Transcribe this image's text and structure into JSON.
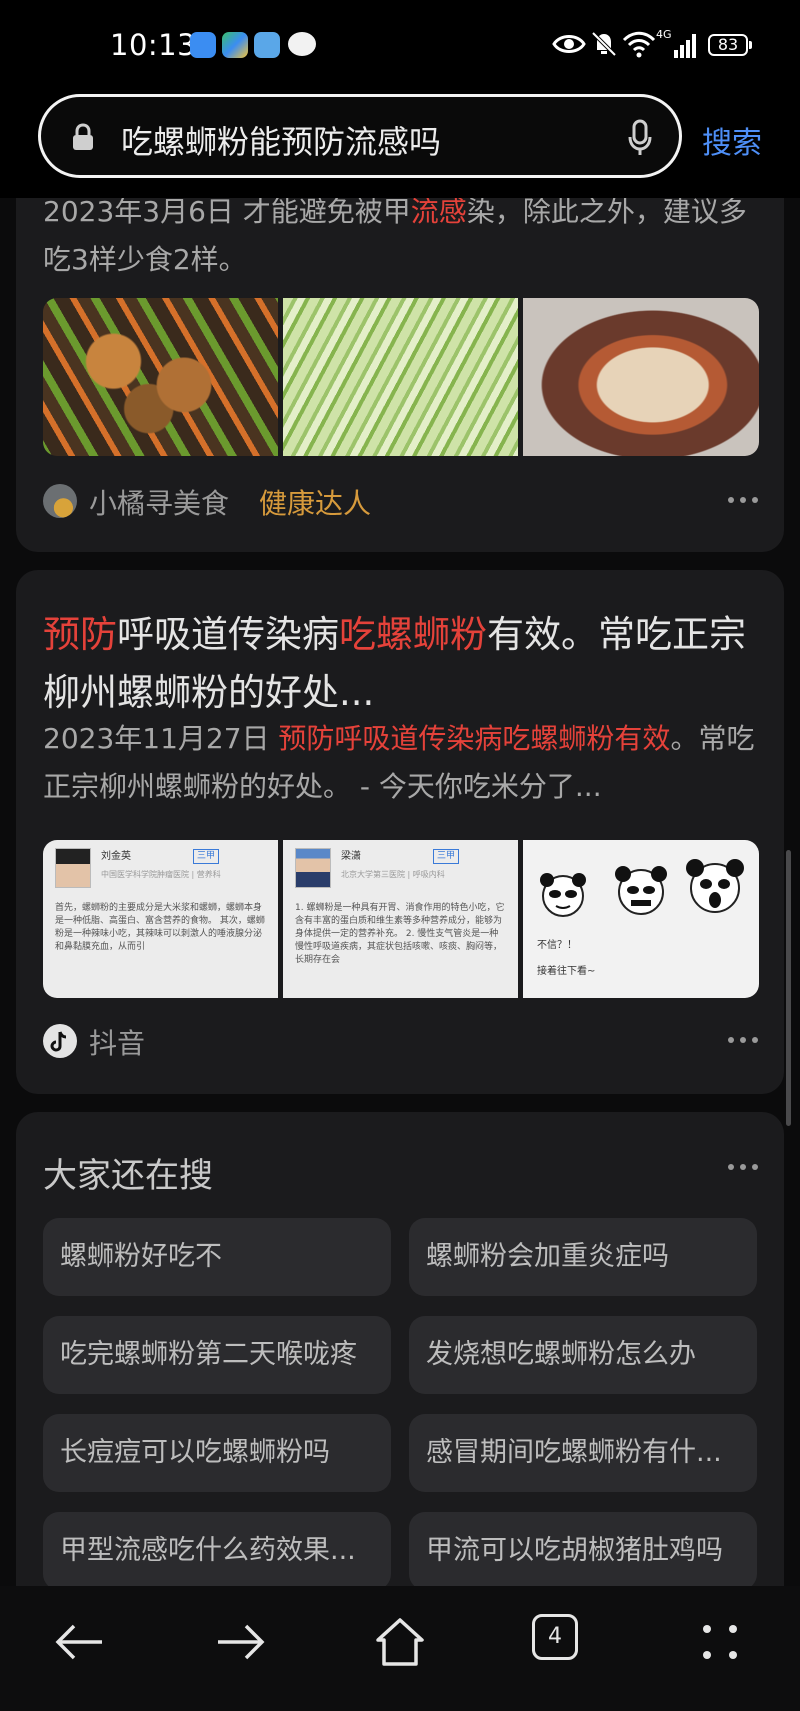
{
  "status_bar": {
    "time": "10:13",
    "network": "4G",
    "battery": "83"
  },
  "search": {
    "query": "吃螺蛳粉能预防流感吗",
    "button_label": "搜索"
  },
  "result1": {
    "date": "2023年3月6日",
    "snippet_pre": " 才能避免被甲",
    "snippet_hl": "流感",
    "snippet_post": "染，除此之外，建议多吃3样少食2样。",
    "source_name": "小橘寻美食",
    "source_tag": "健康达人"
  },
  "result2": {
    "title_hl1": "预防",
    "title_mid1": "呼吸道传染病",
    "title_hl2": "吃螺蛳粉",
    "title_rest": "有效。常吃正宗柳州螺蛳粉的好处...",
    "date": "2023年11月27日 ",
    "snippet_hl": "预防呼吸道传染病吃螺蛳粉有效",
    "snippet_post": "。常吃正宗柳州螺蛳粉的好处。 - 今天你吃米分了...",
    "source_name": "抖音",
    "thumb1": {
      "doctor": "刘金英",
      "level": "三甲",
      "dept": "中国医学科学院肿瘤医院 | 营养科",
      "text": "首先，螺蛳粉的主要成分是大米浆和螺蛳，螺蛳本身是一种低脂、高蛋白、富含营养的食物。 其次，螺蛳粉是一种辣味小吃，其辣味可以刺激人的唾液腺分泌和鼻黏膜充血，从而引"
    },
    "thumb2": {
      "doctor": "梁潇",
      "level": "三甲",
      "dept": "北京大学第三医院 | 呼吸内科",
      "text": "1. 螺蛳粉是一种具有开胃、消食作用的特色小吃，它含有丰富的蛋白质和维生素等多种营养成分，能够为身体提供一定的营养补充。 2. 慢性支气管炎是一种慢性呼吸道疾病，其症状包括咳嗽、咳痰、胸闷等，长期存在会"
    },
    "thumb3": {
      "line1": "不信？！",
      "line2": "接着往下看~"
    }
  },
  "related": {
    "title": "大家还在搜",
    "items": [
      "螺蛳粉好吃不",
      "螺蛳粉会加重炎症吗",
      "吃完螺蛳粉第二天喉咙疼",
      "发烧想吃螺蛳粉怎么办",
      "长痘痘可以吃螺蛳粉吗",
      "感冒期间吃螺蛳粉有什...",
      "甲型流感吃什么药效果...",
      "甲流可以吃胡椒猪肚鸡吗"
    ]
  },
  "nav": {
    "tabs_count": "4"
  },
  "colors": {
    "highlight": "#e5423a",
    "accent": "#4e8ff7",
    "tag": "#d69a3c"
  }
}
